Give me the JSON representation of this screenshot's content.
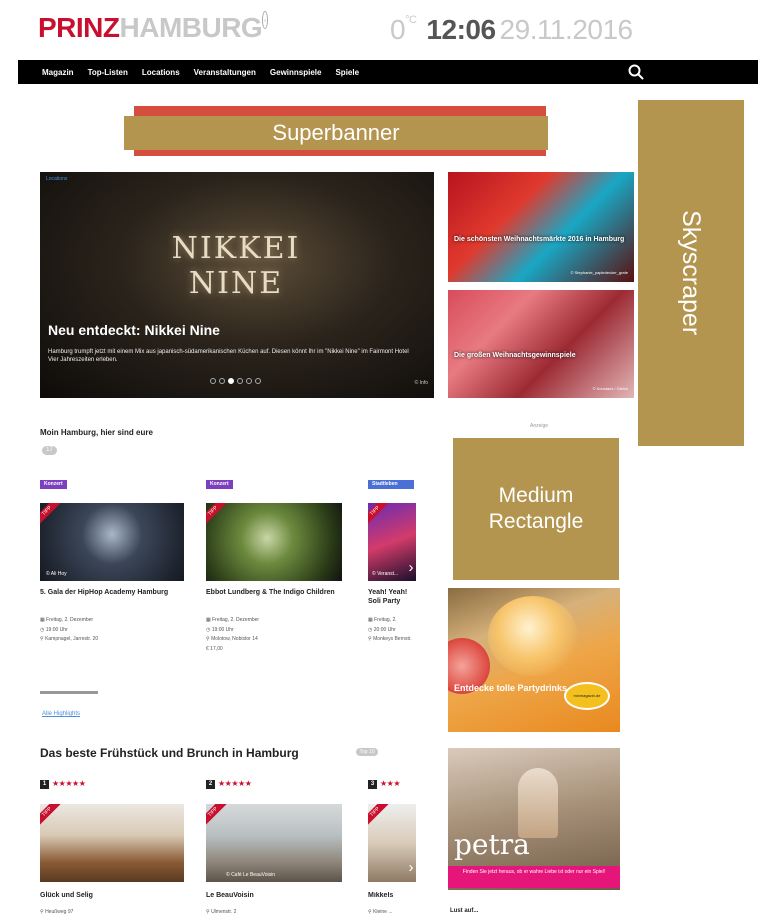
{
  "header": {
    "logo_primary": "PRINZ",
    "logo_secondary": "HAMBURG",
    "logo_dot": "·",
    "temperature": "0",
    "temperature_unit": "°C",
    "time": "12:06",
    "date": "29.11.2016"
  },
  "nav": {
    "items": [
      "Magazin",
      "Top-Listen",
      "Locations",
      "Veranstaltungen",
      "Gewinnspiele",
      "Spiele"
    ]
  },
  "ads": {
    "superbanner": "Superbanner",
    "skyscraper": "Skyscraper",
    "medium_rectangle": "Medium Rectangle",
    "anzeige": "Anzeige"
  },
  "hero": {
    "tag": "Locations",
    "logo_text": "NIKKEI NINE",
    "title": "Neu entdeckt: Nikkei Nine",
    "text": "Hamburg trumpft jetzt mit einem Mix aus japanisch-südamerikanischen Küchen auf. Diesen könnt Ihr im \"Nikkei Nine\" im Fairmont Hotel Vier Jahreszeiten erleben.",
    "credit": "© Info",
    "slide_count": 6,
    "active_slide": 3
  },
  "tiles": [
    {
      "title": "Die schönsten Weihnachtsmärkte 2016 in Hamburg",
      "credit": "© Stephanie_papledecker_grafe"
    },
    {
      "title": "Die großen Weihnachtsgewinnspiele",
      "credit": "© Konstanz / Gleich"
    }
  ],
  "events": {
    "heading": "Moin Hamburg, hier sind eure",
    "count": "17",
    "tip_label": "TIPP",
    "link_all": "Alle Highlights",
    "cards": [
      {
        "category": "Konzert",
        "category_color": "#7b3fbf",
        "overlay": "© Ali Hoy",
        "title": "5. Gala der HipHop Academy Hamburg",
        "date": "Freitag, 2. Dezember",
        "time": "19:00 Uhr",
        "place": "Kampnagel, Jarrestr. 20",
        "price": ""
      },
      {
        "category": "Konzert",
        "category_color": "#7b3fbf",
        "overlay": "",
        "title": "Ebbot Lundberg & The Indigo Children",
        "date": "Freitag, 2. Dezember",
        "time": "19:00 Uhr",
        "place": "Molotow, Nobistor 14",
        "price": "17,00"
      },
      {
        "category": "Stadtleben",
        "category_color": "#4a6fd6",
        "overlay": "© Veranst...",
        "title": "Yeah! Yeah! Soli Party",
        "date": "Freitag, 2.",
        "time": "20:00 Uhr",
        "place": "Monkeys Bernstr.",
        "price": ""
      }
    ]
  },
  "brunch": {
    "heading": "Das beste Frühstück und Brunch in Hamburg",
    "badge": "Top 10",
    "tip_label": "TIPP",
    "items": [
      {
        "rank": "1",
        "stars": "★★★★★",
        "title": "Glück und Selig",
        "address": "Heußweg 97",
        "overlay": ""
      },
      {
        "rank": "2",
        "stars": "★★★★★",
        "title": "Le BeauVoisin",
        "address": "Ulmenstr. 2",
        "overlay": "© Café Le BeauVoisin"
      },
      {
        "rank": "3",
        "stars": "★★★",
        "title": "Mikkels",
        "address": "Kleine ...",
        "overlay": ""
      }
    ]
  },
  "side_ads": {
    "party_text": "Entdecke tolle Partydrinks auf",
    "party_logo": "mixmagazin.de",
    "petra_logo": "petra",
    "petra_strip": "Finden Sie jetzt heraus, ob er wahre Liebe ist oder nur ein Spiel!"
  },
  "lust_auf": "Lust auf..."
}
